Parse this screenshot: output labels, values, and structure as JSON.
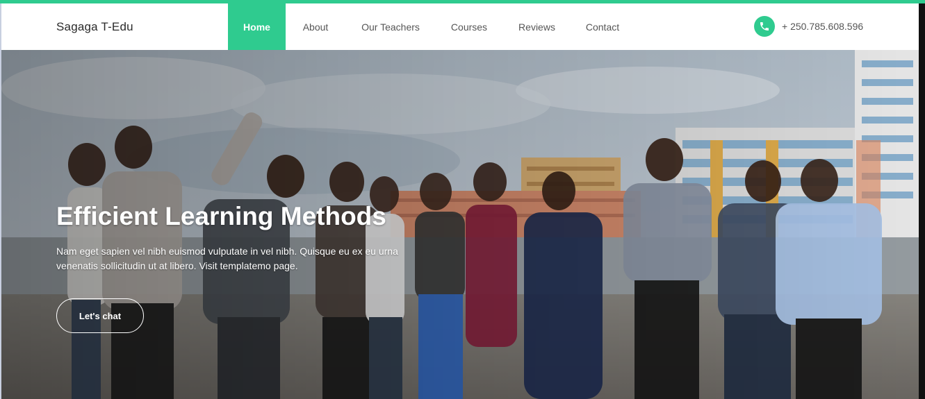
{
  "header": {
    "brand": "Sagaga T-Edu",
    "nav": {
      "home": "Home",
      "about": "About",
      "teachers": "Our Teachers",
      "courses": "Courses",
      "reviews": "Reviews",
      "contact": "Contact"
    },
    "phone": "+ 250.785.608.596"
  },
  "hero": {
    "title": "Efficient Learning Methods",
    "text": "Nam eget sapien vel nibh euismod vulputate in vel nibh. Quisque eu ex eu urna venenatis sollicitudin ut at libero. Visit templatemo page.",
    "button_label": "Let's chat"
  },
  "colors": {
    "accent": "#2fcb8f",
    "nav_text": "#555555",
    "brand_text": "#2a2a2a"
  },
  "icons": {
    "phone": "phone-icon"
  }
}
